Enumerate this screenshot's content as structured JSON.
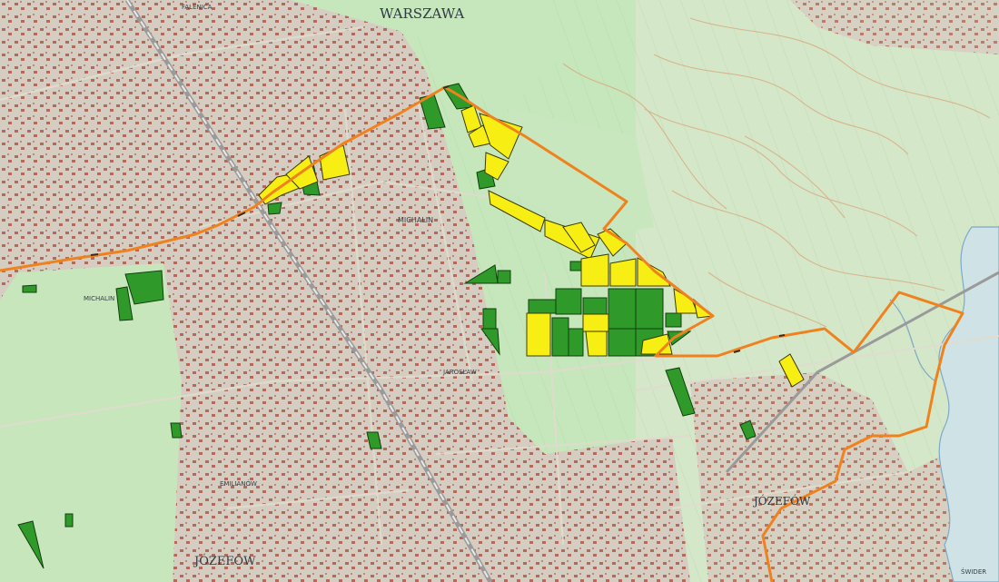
{
  "map": {
    "place_labels": {
      "warszawa": "WARSZAWA",
      "jozefow_main": "JÓZEFÓW",
      "jozefow_east": "JÓZEFÓW",
      "michalin": "MICHALIN",
      "michalin_west": "MICHALIN",
      "emilianow": "EMILIANÓW",
      "jarosław": "JAROSŁAW",
      "falenica": "FALENICA",
      "swider": "ŚWIDER"
    },
    "colors": {
      "boundary": "#f0821e",
      "parcel_green": "#2f9a2a",
      "parcel_yellow": "#f7ee14",
      "forest": "#bfe3b3",
      "forest_east": "#cfe6c4",
      "built_up": "#d9cfc5",
      "building": "#b8705e",
      "road": "#d8d5c6",
      "rail": "#8f8f8f",
      "river_edge": "#7ea9c8",
      "river_fill": "#cfe2e6",
      "contour": "#d6a27a"
    }
  }
}
